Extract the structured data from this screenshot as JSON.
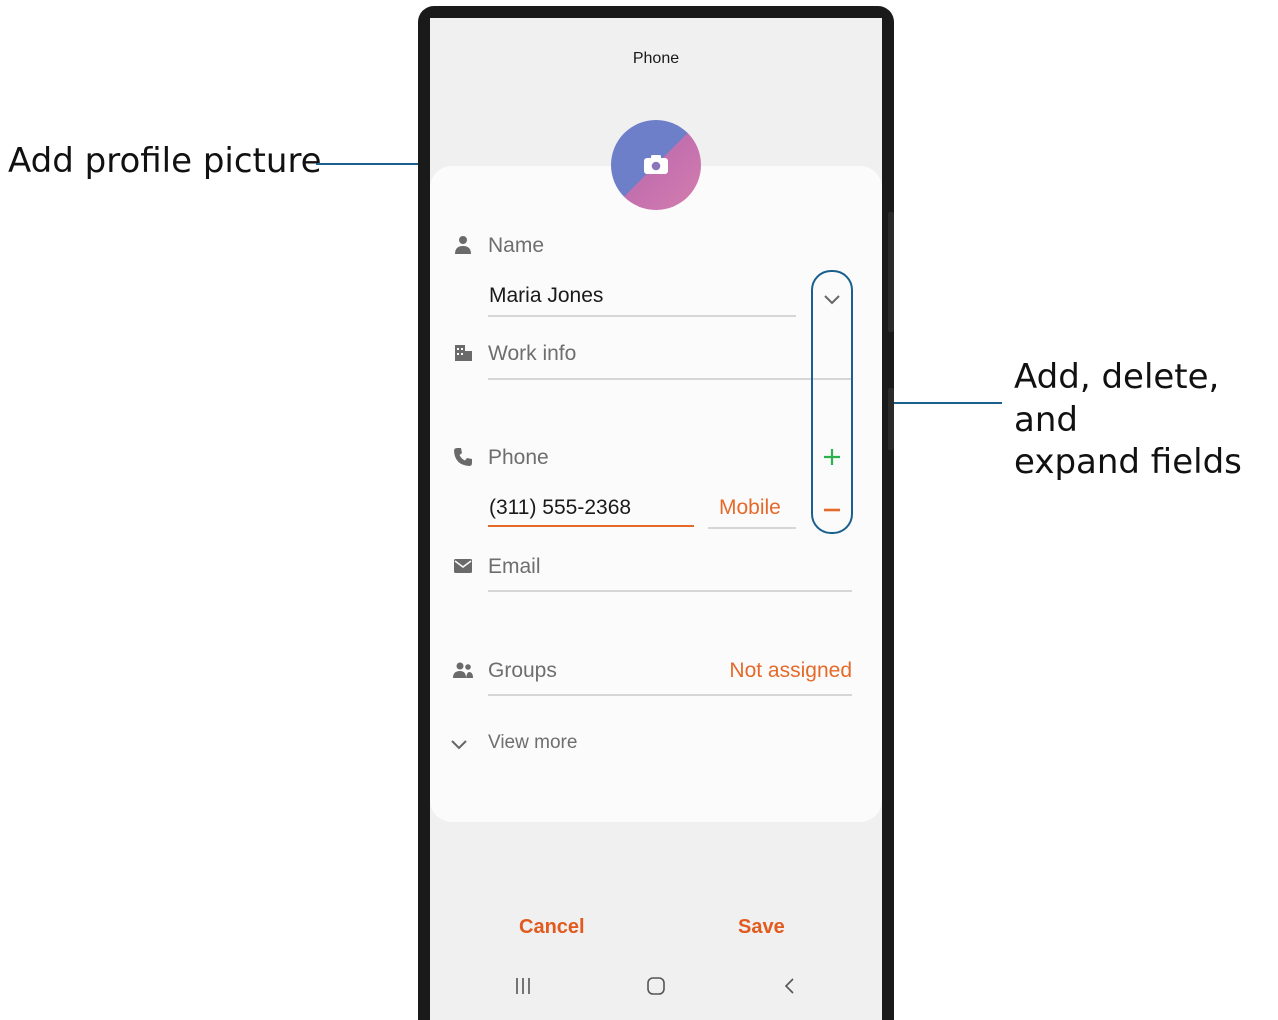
{
  "callouts": {
    "profile": "Add profile picture",
    "fields_line1": "Add, delete, and",
    "fields_line2": "expand fields"
  },
  "app": {
    "title": "Phone"
  },
  "form": {
    "name": {
      "label": "Name",
      "value": "Maria Jones",
      "icon": "person-icon",
      "expand_icon": "chevron-down-icon"
    },
    "work": {
      "label": "Work info",
      "icon": "building-icon"
    },
    "phone": {
      "label": "Phone",
      "value": "(311) 555-2368",
      "type": "Mobile",
      "icon": "phone-icon",
      "add_icon": "plus-icon",
      "remove_icon": "minus-icon"
    },
    "email": {
      "label": "Email",
      "icon": "envelope-icon"
    },
    "groups": {
      "label": "Groups",
      "value": "Not assigned",
      "icon": "groups-icon"
    },
    "view_more": {
      "label": "View more",
      "icon": "chevron-down-icon"
    }
  },
  "actions": {
    "cancel": "Cancel",
    "save": "Save"
  },
  "nav": {
    "recents_icon": "recents-icon",
    "home_icon": "home-icon",
    "back_icon": "back-icon"
  },
  "colors": {
    "accent": "#e25b1e",
    "add": "#2bb24c",
    "remove": "#e56a2a",
    "callout": "#1a5f8e"
  }
}
